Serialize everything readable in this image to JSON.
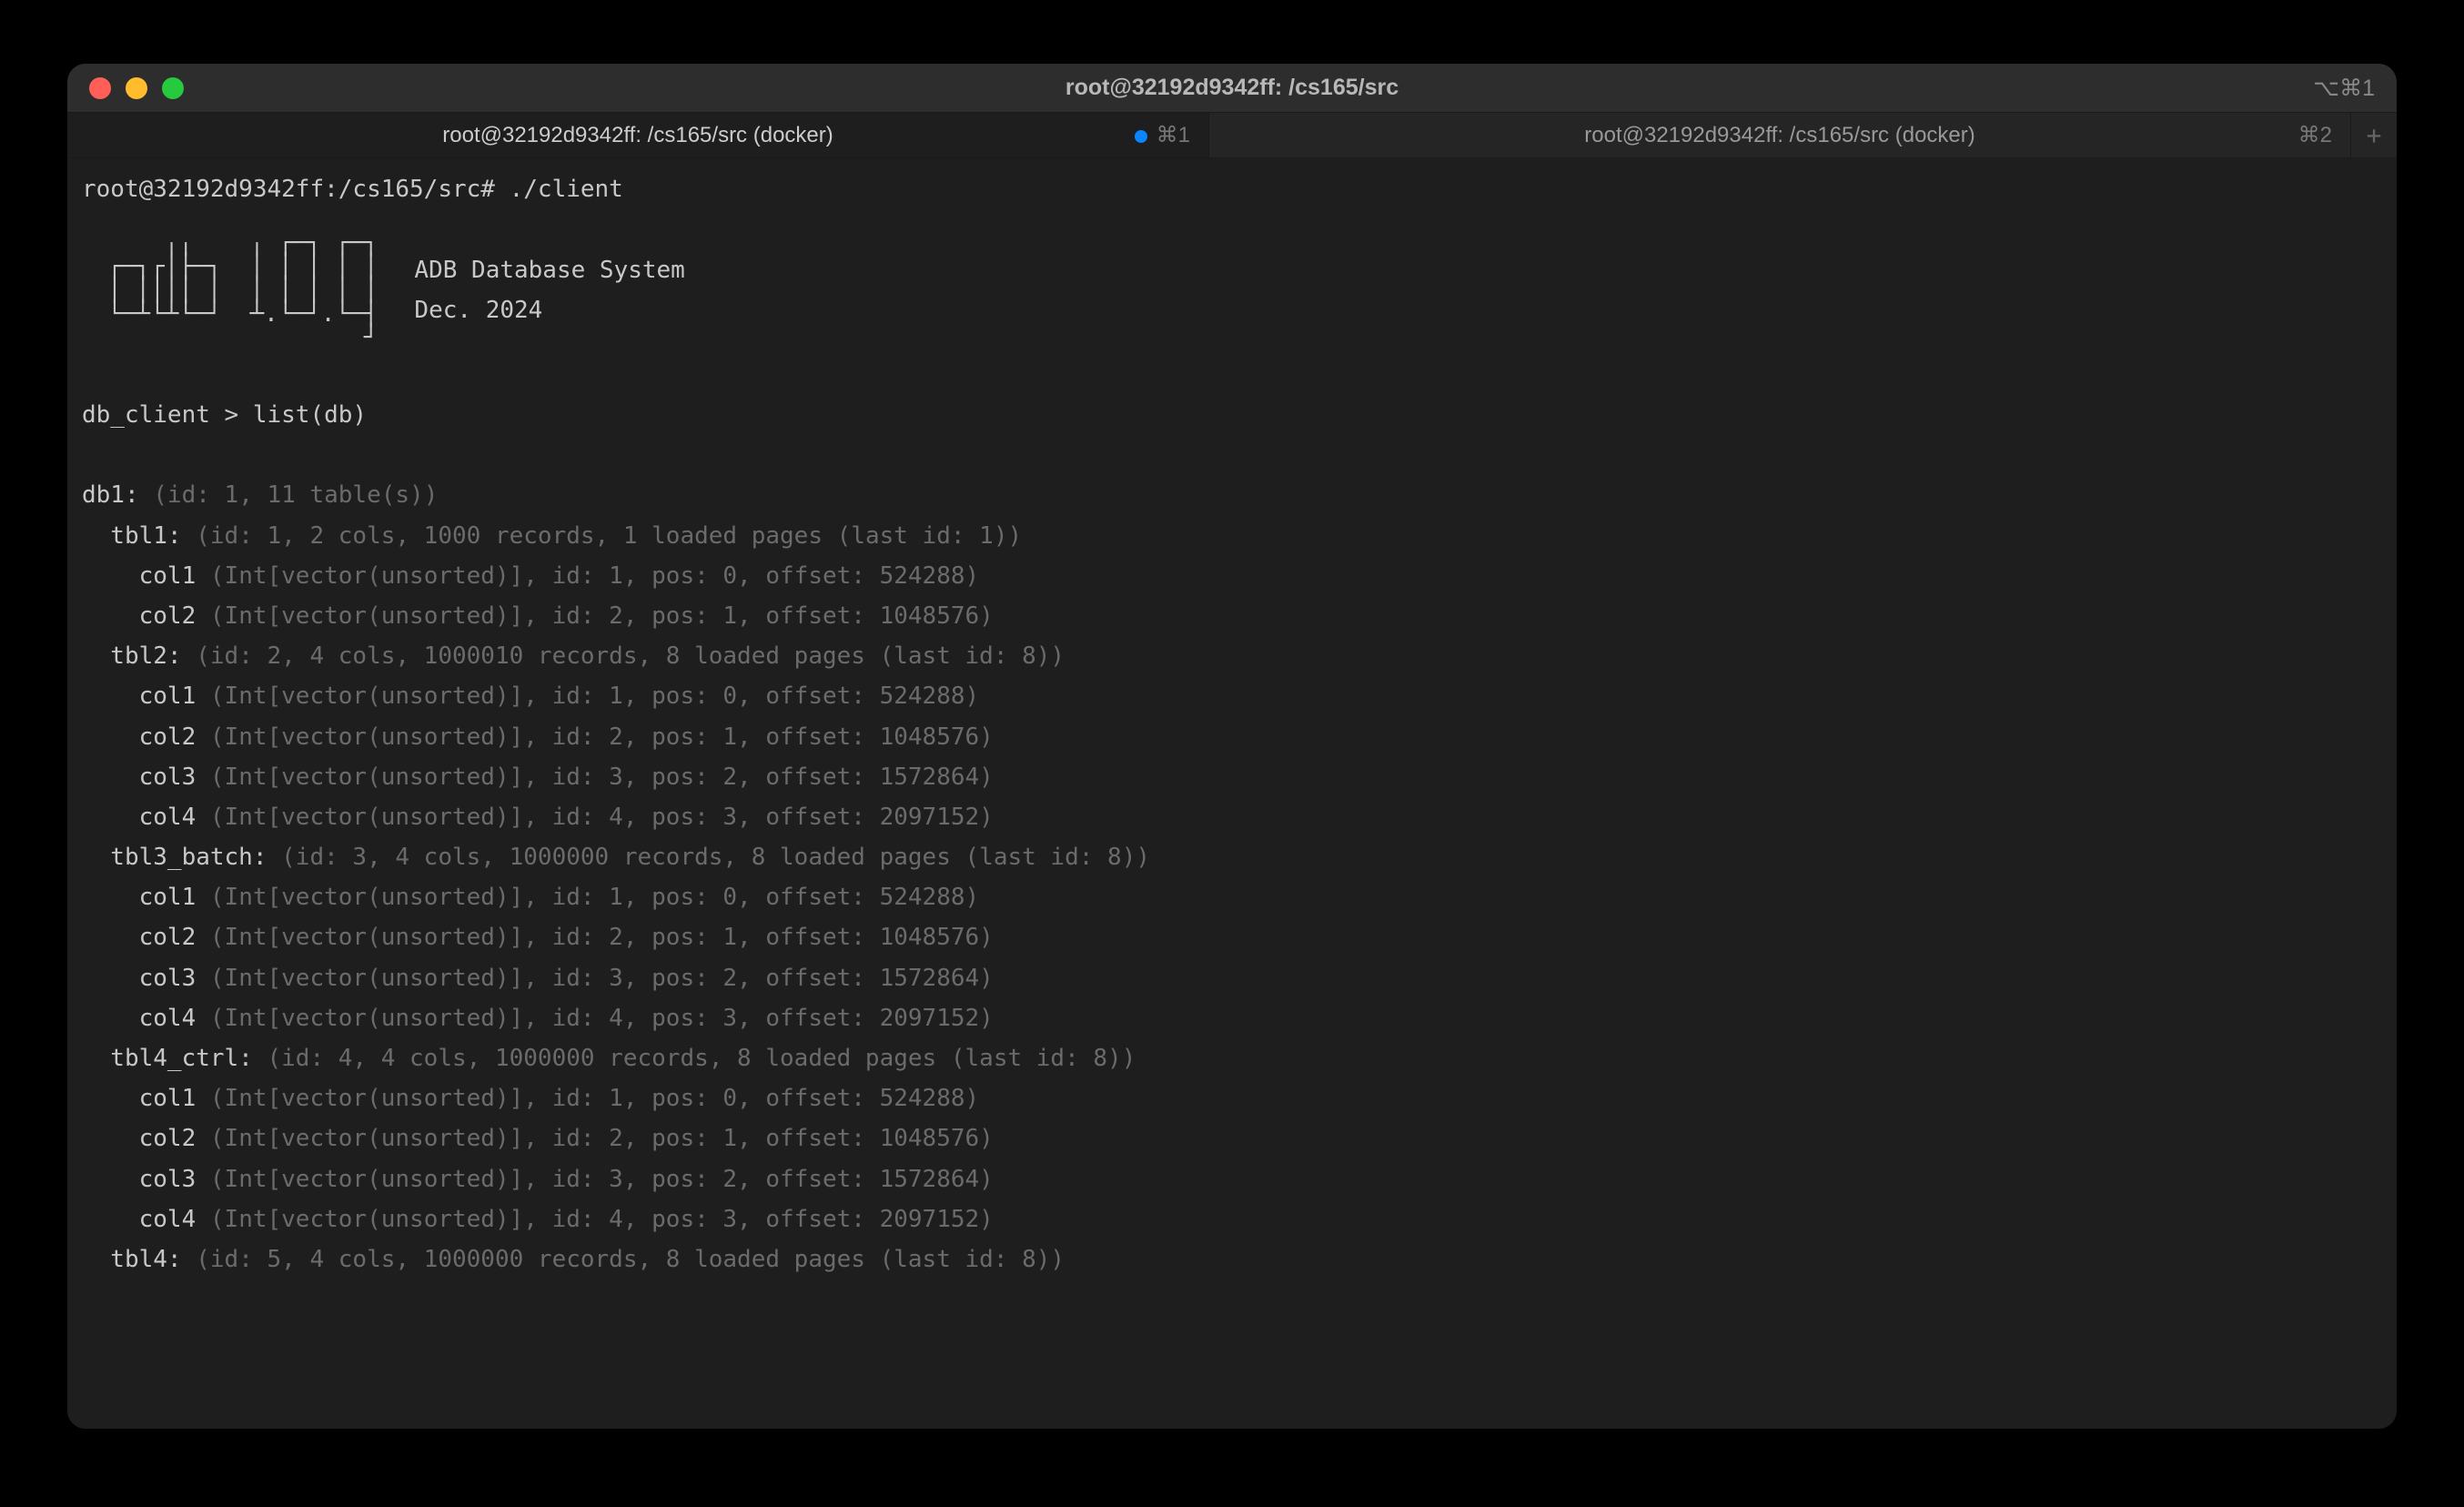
{
  "window": {
    "title": "root@32192d9342ff: /cs165/src",
    "titlebar_right": "⌥⌘1"
  },
  "tabs": [
    {
      "label": "root@32192d9342ff: /cs165/src (docker)",
      "shortcut": "⌘1",
      "active": true,
      "hasIndicator": true
    },
    {
      "label": "root@32192d9342ff: /cs165/src (docker)",
      "shortcut": "⌘2",
      "active": false,
      "hasIndicator": false
    }
  ],
  "shell": {
    "prompt": "root@32192d9342ff:/cs165/src# ",
    "command": "./client"
  },
  "banner": {
    "line1": "ADB Database System",
    "line2": "Dec. 2024"
  },
  "client_prompt": "db_client > ",
  "client_command": "list(db)",
  "db": {
    "name": "db1:",
    "meta": " (id: 1, 11 table(s))",
    "tables": [
      {
        "name": "tbl1:",
        "meta": " (id: 1, 2 cols, 1000 records, 1 loaded pages (last id: 1))",
        "cols": [
          {
            "name": "col1",
            "meta": " (Int[vector(unsorted)], id: 1, pos: 0, offset: 524288)"
          },
          {
            "name": "col2",
            "meta": " (Int[vector(unsorted)], id: 2, pos: 1, offset: 1048576)"
          }
        ]
      },
      {
        "name": "tbl2:",
        "meta": " (id: 2, 4 cols, 1000010 records, 8 loaded pages (last id: 8))",
        "cols": [
          {
            "name": "col1",
            "meta": " (Int[vector(unsorted)], id: 1, pos: 0, offset: 524288)"
          },
          {
            "name": "col2",
            "meta": " (Int[vector(unsorted)], id: 2, pos: 1, offset: 1048576)"
          },
          {
            "name": "col3",
            "meta": " (Int[vector(unsorted)], id: 3, pos: 2, offset: 1572864)"
          },
          {
            "name": "col4",
            "meta": " (Int[vector(unsorted)], id: 4, pos: 3, offset: 2097152)"
          }
        ]
      },
      {
        "name": "tbl3_batch:",
        "meta": " (id: 3, 4 cols, 1000000 records, 8 loaded pages (last id: 8))",
        "cols": [
          {
            "name": "col1",
            "meta": " (Int[vector(unsorted)], id: 1, pos: 0, offset: 524288)"
          },
          {
            "name": "col2",
            "meta": " (Int[vector(unsorted)], id: 2, pos: 1, offset: 1048576)"
          },
          {
            "name": "col3",
            "meta": " (Int[vector(unsorted)], id: 3, pos: 2, offset: 1572864)"
          },
          {
            "name": "col4",
            "meta": " (Int[vector(unsorted)], id: 4, pos: 3, offset: 2097152)"
          }
        ]
      },
      {
        "name": "tbl4_ctrl:",
        "meta": " (id: 4, 4 cols, 1000000 records, 8 loaded pages (last id: 8))",
        "cols": [
          {
            "name": "col1",
            "meta": " (Int[vector(unsorted)], id: 1, pos: 0, offset: 524288)"
          },
          {
            "name": "col2",
            "meta": " (Int[vector(unsorted)], id: 2, pos: 1, offset: 1048576)"
          },
          {
            "name": "col3",
            "meta": " (Int[vector(unsorted)], id: 3, pos: 2, offset: 1572864)"
          },
          {
            "name": "col4",
            "meta": " (Int[vector(unsorted)], id: 4, pos: 3, offset: 2097152)"
          }
        ]
      },
      {
        "name": "tbl4:",
        "meta": " (id: 5, 4 cols, 1000000 records, 8 loaded pages (last id: 8))",
        "cols": []
      }
    ]
  }
}
